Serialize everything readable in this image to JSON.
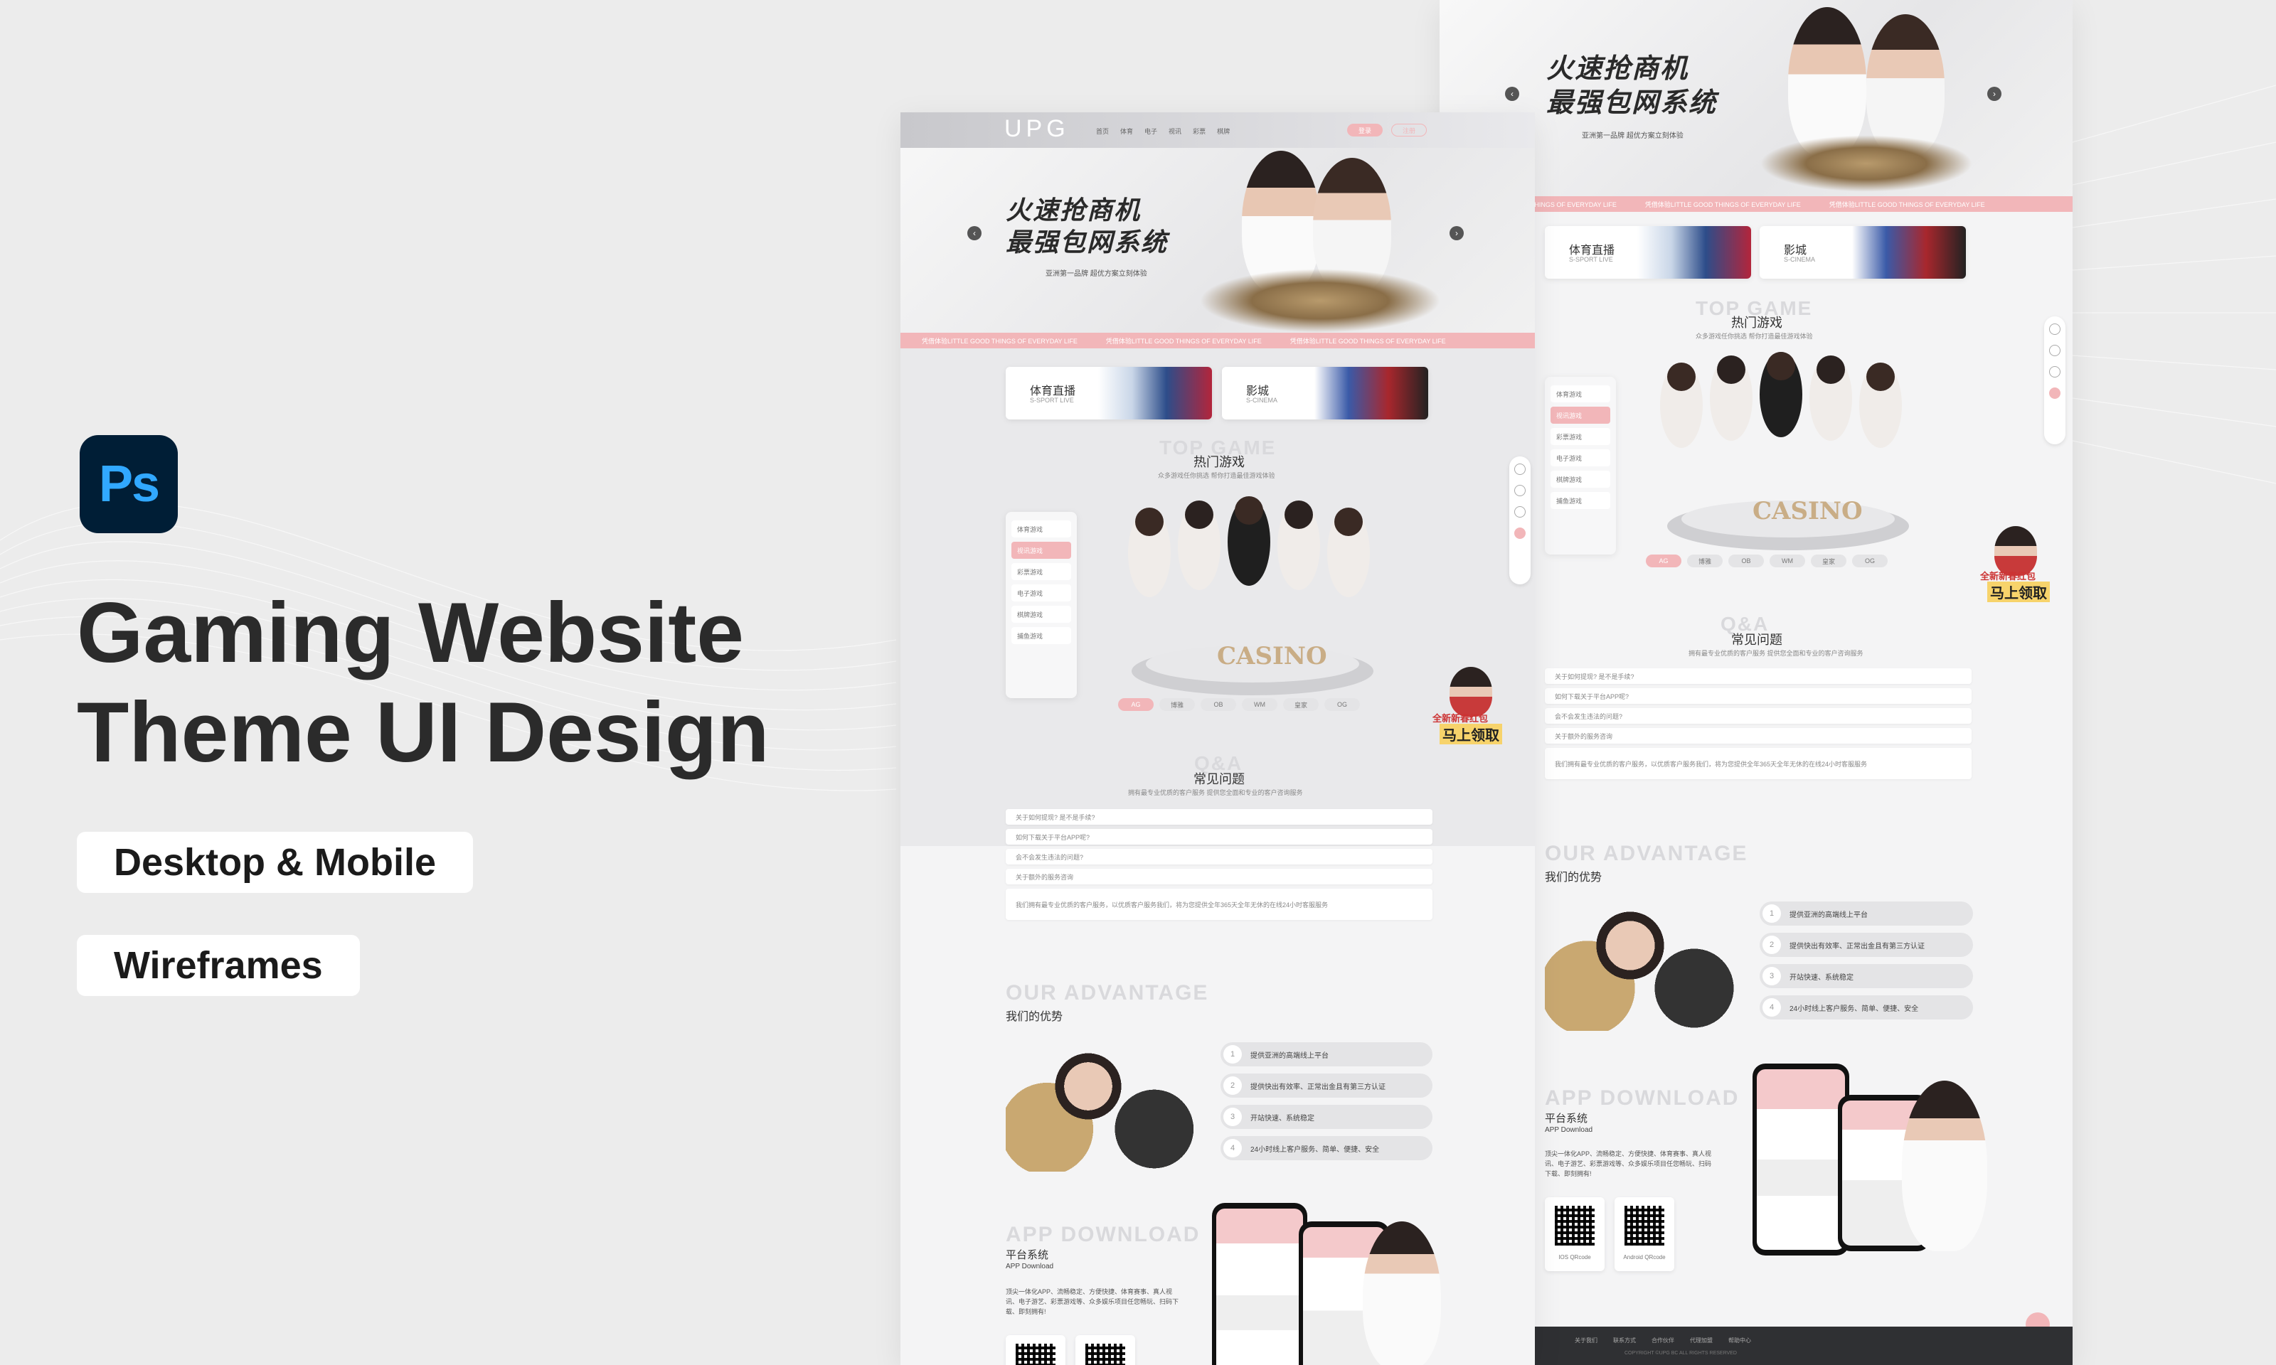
{
  "left": {
    "headline_line1": "Gaming Website",
    "headline_line2": "Theme UI Design",
    "pill_1": "Desktop & Mobile",
    "pill_2": "Wireframes",
    "ps_logo": "Ps"
  },
  "desktop": {
    "logo": "UPG",
    "nav": [
      "首页",
      "体育",
      "电子",
      "视讯",
      "彩票",
      "棋牌"
    ],
    "login": "登录",
    "register": "注册",
    "hero_title_1": "火速抢商机",
    "hero_title_2": "最强包网系统",
    "hero_sub": "亚洲第一品牌  超优方案立刻体验",
    "ticker": "凭借体验LITTLE GOOD THINGS OF EVERYDAY LIFE",
    "cat_1_title": "体育直播",
    "cat_1_sub": "S-SPORT LIVE",
    "cat_2_title": "影城",
    "cat_2_sub": "S-CINEMA",
    "top_game_ghost": "TOP GAME",
    "top_game_title": "热门游戏",
    "top_game_desc": "众多游戏任你挑选 帮你打造最佳游戏体验",
    "menu": [
      "体育游戏",
      "视讯游戏",
      "彩票游戏",
      "电子游戏",
      "棋牌游戏",
      "捕鱼游戏"
    ],
    "brands": [
      "AG",
      "博雅",
      "OB",
      "WM",
      "皇家",
      "OG"
    ],
    "casino_sign": "CASINO",
    "promo_1": "全新新春红包",
    "promo_2": "马上领取",
    "qa_ghost": "Q&A",
    "qa_title": "常见问题",
    "qa_desc": "拥有最专业优质的客户服务 提供您全面和专业的客户咨询服务",
    "faq": [
      "关于如何提现? 是不是手续?",
      "如何下载关于平台APP呢?",
      "会不会发生违法的问题?",
      "关于额外的服务咨询"
    ],
    "faq_answer": "我们拥有最专业优质的客户服务，以优质客户服务我们，将为您提供全年365天全年无休的在线24小时客服服务",
    "adv_ghost": "OUR ADVANTAGE",
    "adv_title": "我们的优势",
    "advantages": [
      "提供亚洲的高端线上平台",
      "提供快出有效率、正常出金且有第三方认证",
      "开站快速、系统稳定",
      "24小时线上客户服务、简单、便捷、安全"
    ],
    "app_ghost": "APP DOWNLOAD",
    "app_title": "平台系统",
    "app_subtitle": "APP Download",
    "app_desc": "顶尖一体化APP、流畅稳定、方便快捷、体育赛事、真人视讯、电子游艺、彩票游戏等、众多娱乐项目任您畅玩、扫码下载、即刻拥有!"
  },
  "mobile": {
    "hero_title_1": "火速抢商机",
    "hero_title_2": "最强包网系统",
    "hero_sub": "亚洲第一品牌  超优方案立刻体验",
    "ticker": "凭借体验LITTLE GOOD THINGS OF EVERYDAY LIFE",
    "cat_1_title": "体育直播",
    "cat_1_sub": "S-SPORT LIVE",
    "cat_2_title": "影城",
    "cat_2_sub": "S-CINEMA",
    "top_game_ghost": "TOP GAME",
    "top_game_title": "热门游戏",
    "top_game_desc": "众多游戏任你挑选 帮你打造最佳游戏体验",
    "menu": [
      "体育游戏",
      "视讯游戏",
      "彩票游戏",
      "电子游戏",
      "棋牌游戏",
      "捕鱼游戏"
    ],
    "brands": [
      "AG",
      "博雅",
      "OB",
      "WM",
      "皇家",
      "OG"
    ],
    "casino_sign": "CASINO",
    "promo_1": "全新新春红包",
    "promo_2": "马上领取",
    "qa_ghost": "Q&A",
    "qa_title": "常见问题",
    "qa_desc": "拥有最专业优质的客户服务 提供您全面和专业的客户咨询服务",
    "faq": [
      "关于如何提现? 是不是手续?",
      "如何下载关于平台APP呢?",
      "会不会发生违法的问题?",
      "关于额外的服务咨询"
    ],
    "faq_answer": "我们拥有最专业优质的客户服务，以优质客户服务我们，将为您提供全年365天全年无休的在线24小时客服服务",
    "adv_ghost": "OUR ADVANTAGE",
    "adv_title": "我们的优势",
    "advantages": [
      "提供亚洲的高端线上平台",
      "提供快出有效率、正常出金且有第三方认证",
      "开站快速、系统稳定",
      "24小时线上客户服务、简单、便捷、安全"
    ],
    "app_ghost": "APP DOWNLOAD",
    "app_title": "平台系统",
    "app_subtitle": "APP Download",
    "app_desc": "顶尖一体化APP、流畅稳定、方便快捷、体育赛事、真人视讯、电子游艺、彩票游戏等、众多娱乐项目任您畅玩、扫码下载、即刻拥有!",
    "qr_1": "IOS QRcode",
    "qr_2": "Android QRcode",
    "footer_links": [
      "关于我们",
      "联系方式",
      "合作伙伴",
      "代理加盟",
      "帮助中心"
    ],
    "copyright": "COPYRIGHT ©UPG BC ALL RIGHTS RESERVED"
  },
  "colors": {
    "accent_pink": "#f2b6b9",
    "ps_blue_bg": "#001e36",
    "ps_blue_text": "#31a8ff",
    "footer_dark": "#2f3033"
  }
}
